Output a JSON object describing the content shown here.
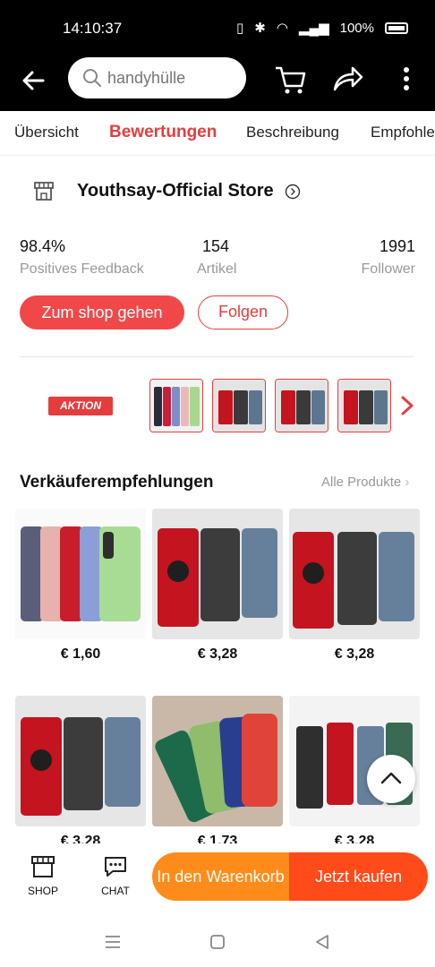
{
  "status": {
    "time": "14:10:37",
    "battery": "100%"
  },
  "search": {
    "placeholder": "handyhülle"
  },
  "tabs": [
    "Übersicht",
    "Bewertungen",
    "Beschreibung",
    "Empfohle"
  ],
  "store": {
    "name": "Youthsay-Official Store",
    "stats": [
      {
        "value": "98.4%",
        "label": "Positives Feedback"
      },
      {
        "value": "154",
        "label": "Artikel"
      },
      {
        "value": "1991",
        "label": "Follower"
      }
    ],
    "shop_button": "Zum shop gehen",
    "follow_button": "Folgen"
  },
  "promo": {
    "badge": "AKTION"
  },
  "recommend": {
    "title": "Verkäuferempfehlungen",
    "link": "Alle Produkte",
    "products": [
      {
        "price": "€ 1,60"
      },
      {
        "price": "€ 3,28"
      },
      {
        "price": "€ 3,28"
      },
      {
        "price": "€ 3,28"
      },
      {
        "price": "€ 1,73"
      },
      {
        "price": "€ 3,28"
      }
    ]
  },
  "bottom": {
    "shop": "SHOP",
    "chat": "CHAT",
    "cart": "In den Warenkorb",
    "buy": "Jetzt kaufen"
  },
  "colors": {
    "accent": "#e53d3d",
    "orange": "#ff8c1a",
    "orange_red": "#ff4a1a"
  }
}
